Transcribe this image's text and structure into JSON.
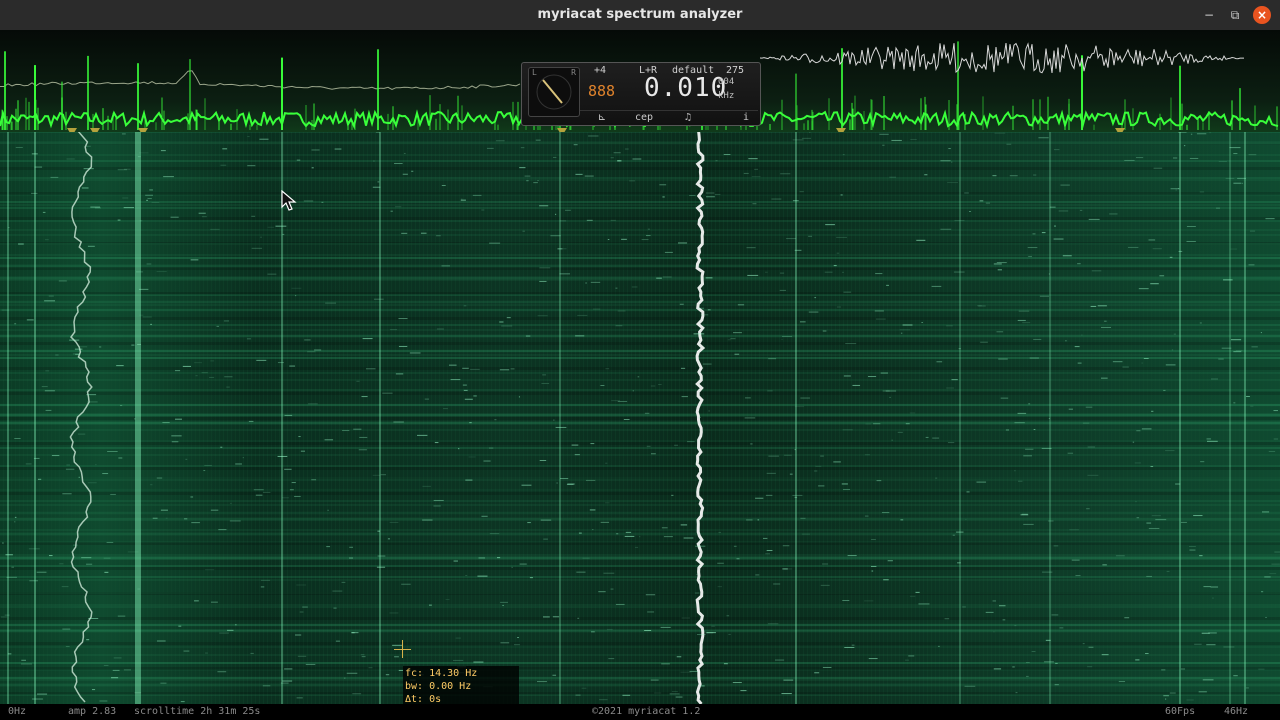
{
  "window": {
    "title": "myriacat spectrum analyzer",
    "controls": {
      "minimize": "−",
      "maximize": "⧉",
      "close": "×"
    }
  },
  "widget": {
    "channel_l": "L",
    "channel_r": "R",
    "gain": "+4",
    "mode": "L+R",
    "preset": "default",
    "count": "275",
    "small_value": "888",
    "frequency": "0.010",
    "sub_value": "004",
    "unit": "kHz",
    "buttons": [
      {
        "label": "⊾",
        "icon": "tuning-icon"
      },
      {
        "label": "cep",
        "icon": "cepstrum-icon"
      },
      {
        "label": "♫",
        "icon": "music-note-icon"
      },
      {
        "label": "i",
        "icon": "info-icon"
      }
    ]
  },
  "tooltip": {
    "fc": "fc: 14.30 Hz",
    "bw": "bw: 0.00 Hz",
    "dt": "Δt: 0s"
  },
  "status": {
    "left_freq": "0Hz",
    "amp": "amp 2.83",
    "scrolltime": "scrolltime 2h 31m 25s",
    "copyright": "©2021 myriacat 1.2",
    "fps": "60Fps",
    "right_freq": "46Hz"
  },
  "colors": {
    "spectrum_line": "#39ff3a",
    "waterfall_base": "#0c3a26",
    "accent_orange": "#e95420",
    "tooltip_text": "#ffcc66"
  }
}
